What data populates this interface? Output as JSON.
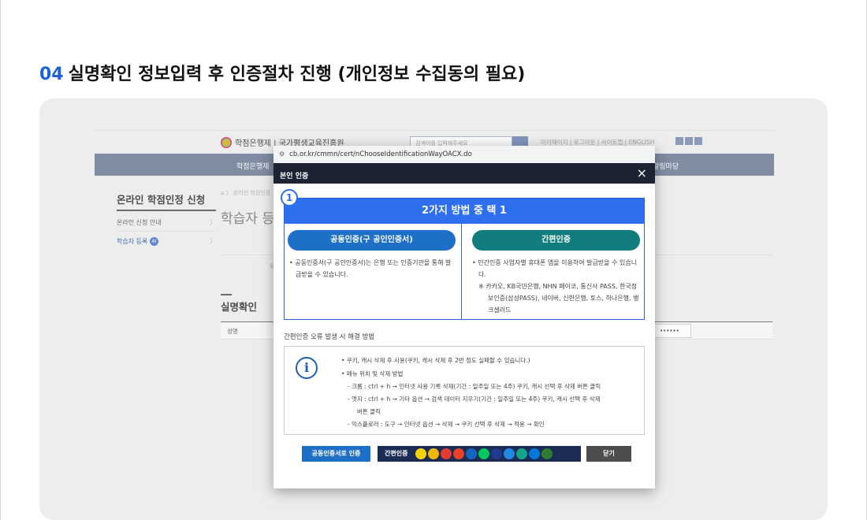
{
  "heading": {
    "num": "04",
    "text": "실명확인 정보입력 후 인증절차 진행 (개인정보 수집동의 필요)"
  },
  "site": {
    "logo": "학점은행제 | 국가평생교육진흥원",
    "search_placeholder": "검색어를 입력해주세요",
    "toplinks": "마이페이지 | 로그아웃 | 사이트맵 | ENGLISH",
    "nav_left": "학점은행제",
    "nav_right": "알림마당",
    "lnb_title": "온라인 학점인정 신청",
    "lnb_items": [
      "온라인 신청 안내",
      "학습자 등록"
    ],
    "lnb_badge": "AI",
    "breadcrumb": "⌂ 〉 온라인 학점인정",
    "page_title": "학습자 등",
    "small_text": "유",
    "section_title": "실명확인",
    "table_head": "성명",
    "password_mask": "••••••"
  },
  "popup": {
    "url": "cb.or.kr/cmmn/cert/nChooseIdentificationWayOACX.do",
    "title": "본인 인증",
    "close_icon": "×",
    "step": "1",
    "choose_title": "2가지 방법 중 택 1",
    "option_a": {
      "label": "공동인증(구 공인인증서)",
      "desc": "• 공동인증서(구 공인인증서)는 은행 또는 인증기관을 통해 발급받을 수 있습니다."
    },
    "option_b": {
      "label": "간편인증",
      "desc": "• 민간인증 사업자별 휴대폰 앱을 이용하여 발급받을 수 있습니다.",
      "note": "※ 카카오, KB국민은행, NHN 페이코, 통신사 PASS, 한국정보인증(삼성PASS), 네이버, 신한은행, 토스, 하나은행, 뱅크샐러드"
    },
    "error_title": "간편인증 오류 발생 시 해결 방법",
    "info": [
      "•  쿠키, 캐시 삭제 후 사용(쿠키, 캐시 삭제 후 2번 정도 실패할 수 있습니다.)",
      "•  메뉴 위치 및 삭제 방법",
      "-  크롬 : ctrl + h → 인터넷 사용 기록 삭제(기간 : 일주일 또는 4주) 쿠키, 캐시 선택 후 삭제 버튼 클릭",
      "-  엣지 : ctrl + h → 기타 옵션 → 검색 데이터 지우기(기간 : 일주일 또는 4주) 쿠키, 캐시 선택 후 삭제",
      "버튼 클릭",
      "-  익스플로러 : 도구 → 인터넷 옵션 → 삭제 → 쿠키 선택 후 삭제 → 적용 → 확인"
    ],
    "buttons": {
      "cert": "공동인증서로 인증",
      "simple": "간편인증",
      "close": "닫기"
    },
    "provider_colors": [
      "#f7d300",
      "#f2b800",
      "#e53935",
      "#e8412c",
      "#1565c0",
      "#03c75a",
      "#1f3a93",
      "#1e88e5",
      "#17a589",
      "#0078d7",
      "#2e7d32"
    ]
  }
}
